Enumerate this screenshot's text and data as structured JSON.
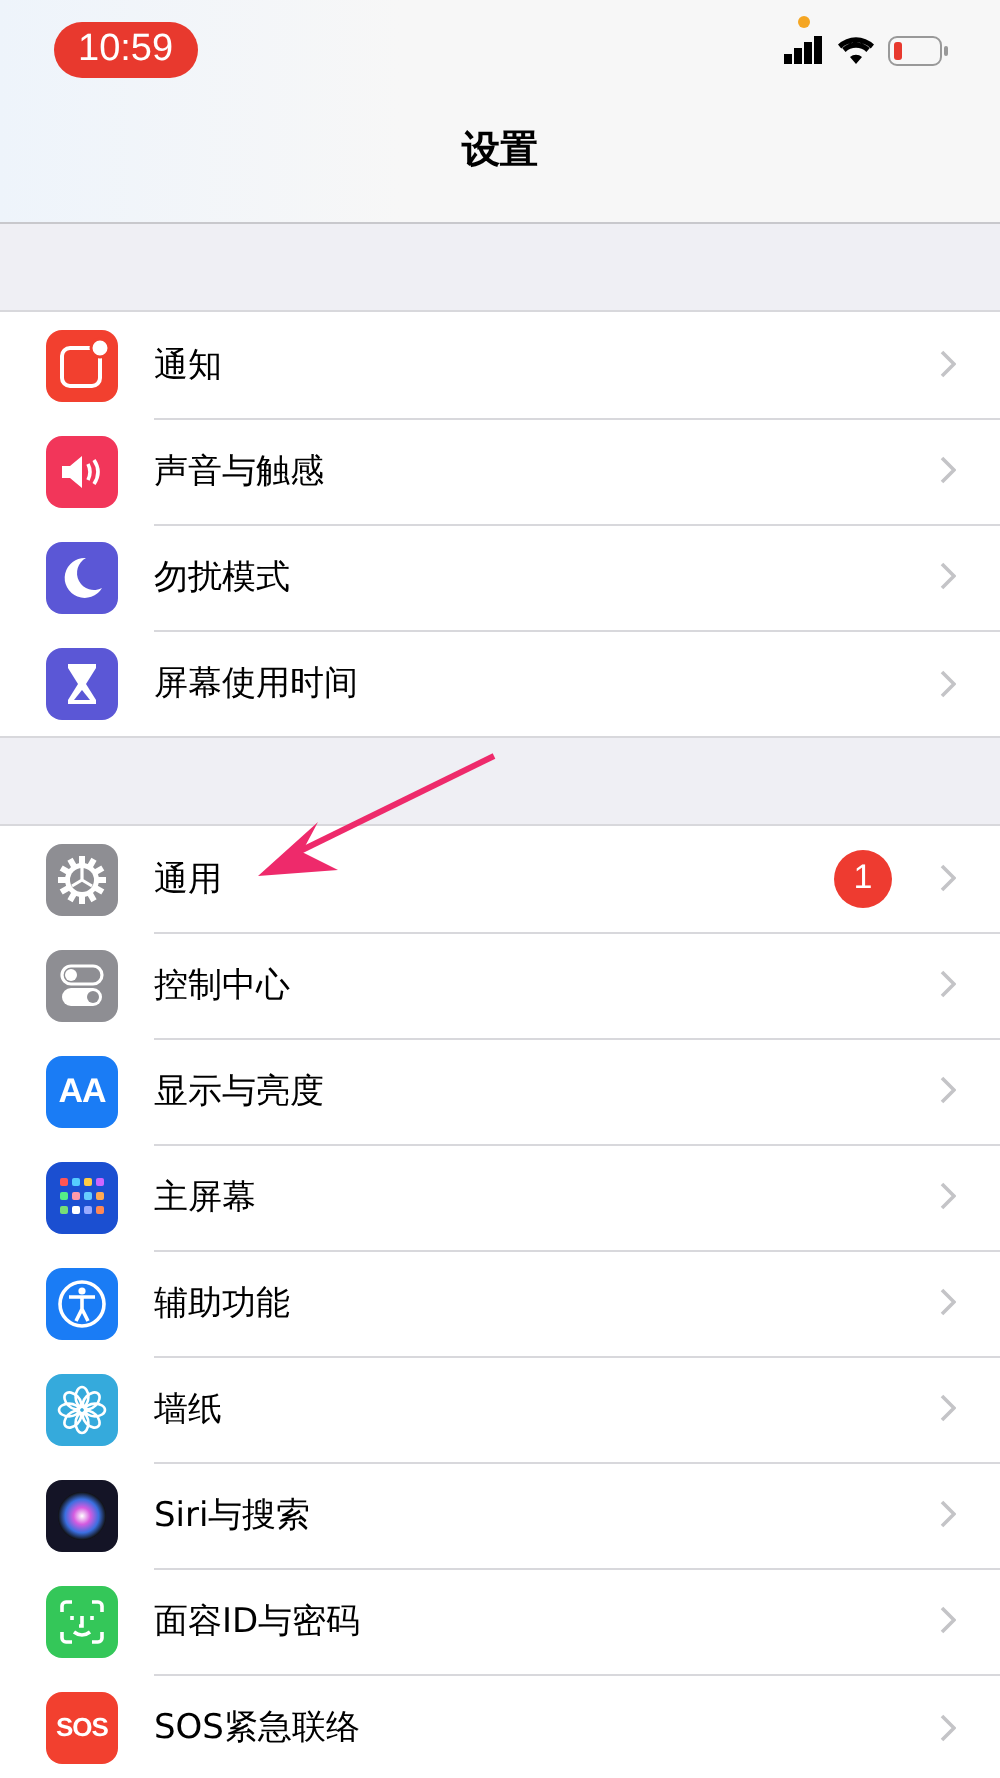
{
  "status_bar": {
    "time": "10:59"
  },
  "nav": {
    "title": "设置"
  },
  "groups": [
    {
      "rows": [
        {
          "label": "通知"
        },
        {
          "label": "声音与触感"
        },
        {
          "label": "勿扰模式"
        },
        {
          "label": "屏幕使用时间"
        }
      ]
    },
    {
      "rows": [
        {
          "label": "通用",
          "badge": "1"
        },
        {
          "label": "控制中心"
        },
        {
          "label": "显示与亮度",
          "icon_text": "AA"
        },
        {
          "label": "主屏幕"
        },
        {
          "label": "辅助功能"
        },
        {
          "label": "墙纸"
        },
        {
          "label": "Siri与搜索"
        },
        {
          "label": "面容ID与密码"
        },
        {
          "label": "SOS紧急联络",
          "icon_text": "SOS"
        }
      ]
    }
  ]
}
